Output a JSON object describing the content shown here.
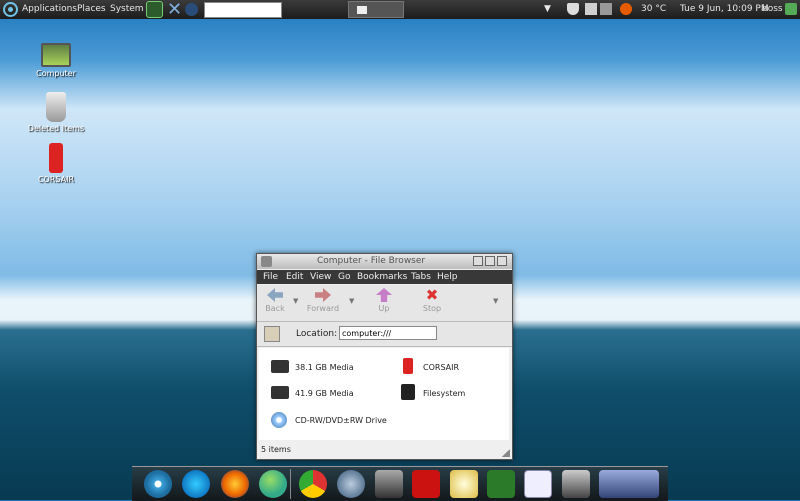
{
  "top_panel": {
    "menu": [
      "Applications",
      "Places",
      "System"
    ],
    "weather": "30 °C",
    "clock": "Tue  9 Jun, 10:09 PM",
    "user": "boss",
    "icons": [
      "ubuntu-logo",
      "terminal",
      "x-logo",
      "browser",
      "shield",
      "clipboard",
      "network",
      "sound"
    ]
  },
  "desktop": {
    "icons": [
      {
        "label": "Computer",
        "icon": "computer"
      },
      {
        "label": "Deleted Items",
        "icon": "trash"
      },
      {
        "label": "CORSAIR",
        "icon": "usb-drive"
      }
    ]
  },
  "file_browser": {
    "title": "Computer - File Browser",
    "menu": [
      "File",
      "Edit",
      "View",
      "Go",
      "Bookmarks",
      "Tabs",
      "Help"
    ],
    "toolbar": {
      "back": "Back",
      "forward": "Forward",
      "up": "Up",
      "stop": "Stop"
    },
    "location_label": "Location:",
    "location_value": "computer:///",
    "items": [
      {
        "label": "38.1 GB Media",
        "icon": "hard-disk"
      },
      {
        "label": "CORSAIR",
        "icon": "usb-drive"
      },
      {
        "label": "41.9 GB Media",
        "icon": "hard-disk"
      },
      {
        "label": "Filesystem",
        "icon": "filesystem"
      },
      {
        "label": "CD-RW/DVD±RW Drive",
        "icon": "optical-drive"
      }
    ],
    "status": "5 items"
  },
  "dock": {
    "items": [
      "ubuntu",
      "thunderbird",
      "firefox",
      "pidgin",
      "chrome",
      "browser",
      "drive",
      "acrobat",
      "mail",
      "excel",
      "word",
      "drive",
      "desktop-preview"
    ]
  }
}
